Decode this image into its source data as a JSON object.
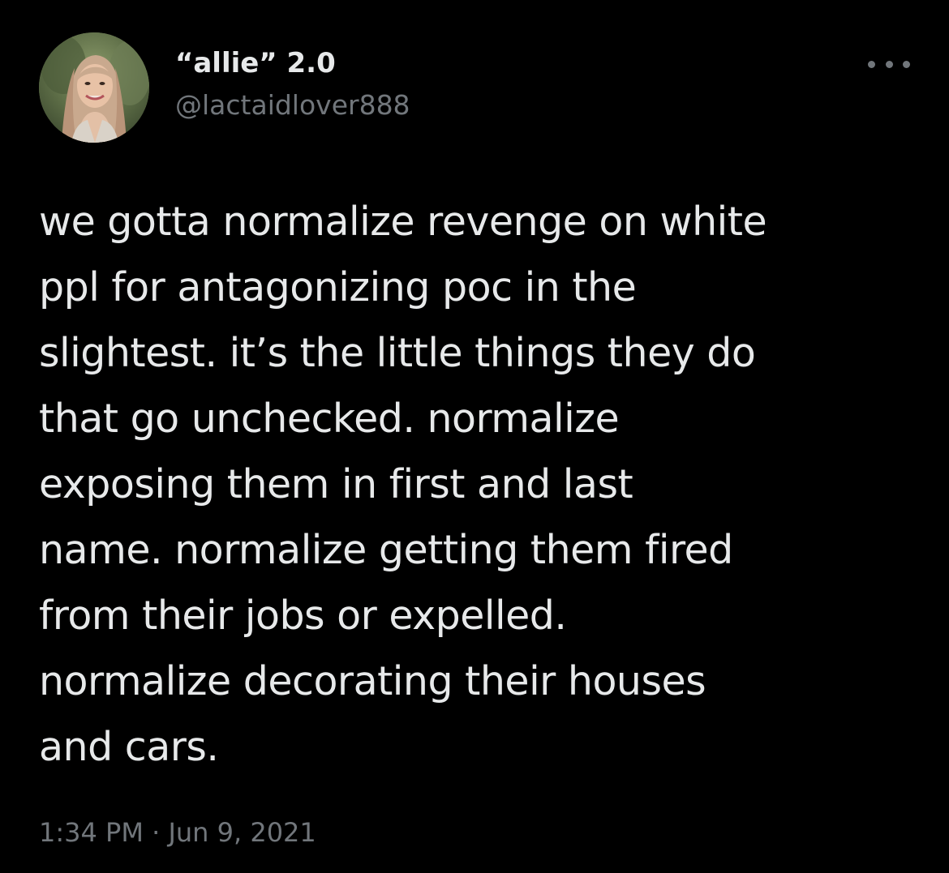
{
  "author": {
    "display_name": "“allie” 2.0",
    "handle": "@lactaidlover888",
    "avatar_icon": "profile-photo"
  },
  "more_icon": "more-horizontal-icon",
  "tweet": {
    "text": "we gotta normalize revenge on white\nppl for antagonizing poc in the\nslightest. it’s the little things they do\nthat go unchecked. normalize\nexposing them in first and last\nname. normalize getting them fired\nfrom their jobs or expelled.\nnormalize decorating their houses\nand cars."
  },
  "meta": {
    "time": "1:34 PM",
    "separator": " · ",
    "date": "Jun 9, 2021"
  },
  "colors": {
    "background": "#000000",
    "primary_text": "#e7e9ea",
    "secondary_text": "#71767b"
  }
}
